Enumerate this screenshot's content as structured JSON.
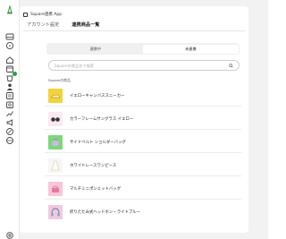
{
  "app": {
    "title": "Square連携 App"
  },
  "tabs": [
    {
      "label": "アカウント設定"
    },
    {
      "label": "連携商品一覧"
    }
  ],
  "segment": {
    "left": "連携中",
    "right": "未連携"
  },
  "search": {
    "placeholder": "Squareの商品名で検索"
  },
  "section": {
    "label": "Squareの商品"
  },
  "products": [
    {
      "name": "イエローキャンバススニーカー",
      "thumb": "yellow-sneaker-icon",
      "bg": "#f3d33c"
    },
    {
      "name": "カラーフレームサングラス イエロー",
      "thumb": "sunglasses-icon",
      "bg": "#fde7f0"
    },
    {
      "name": "サイドベルト ショルダーバッグ",
      "thumb": "shoulder-bag-icon",
      "bg": "#7ed67a"
    },
    {
      "name": "ホワイトレースワンピース",
      "thumb": "white-dress-icon",
      "bg": "#f6f6f6"
    },
    {
      "name": "マルチミニポシェットバッグ",
      "thumb": "pochette-bag-icon",
      "bg": "#f8c6d6"
    },
    {
      "name": "折りたたみ式ヘッドホン・ライトブルー",
      "thumb": "headphones-icon",
      "bg": "#f2c8de"
    }
  ],
  "colors": {
    "accent": "#2f9e44",
    "background": "#f2f2f2",
    "card": "#ffffff"
  }
}
